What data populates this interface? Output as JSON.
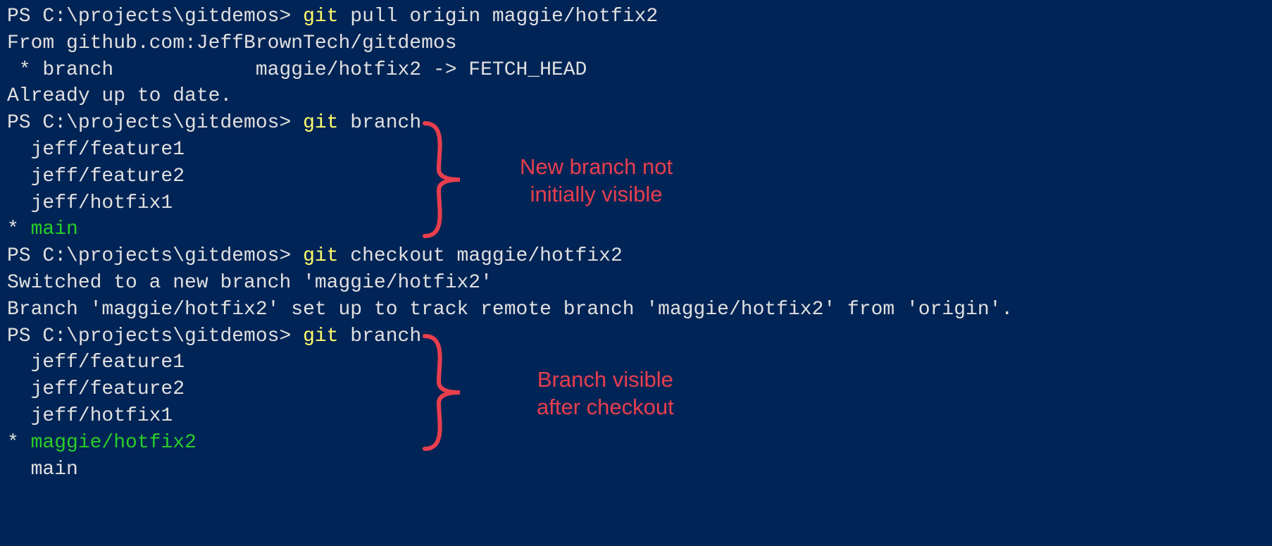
{
  "colors": {
    "background": "#012456",
    "text": "#e0e0e0",
    "yellow": "#ffff6b",
    "green": "#28ce28",
    "annotation": "#e83e4d"
  },
  "lines": {
    "l1_prompt": "PS C:\\projects\\gitdemos> ",
    "l1_git": "git",
    "l1_rest": " pull origin maggie/hotfix2",
    "l2": "From github.com:JeffBrownTech/gitdemos",
    "l3": " * branch            maggie/hotfix2 -> FETCH_HEAD",
    "l4": "Already up to date.",
    "l5_prompt": "PS C:\\projects\\gitdemos> ",
    "l5_git": "git",
    "l5_rest": " branch",
    "l6": "  jeff/feature1",
    "l7": "  jeff/feature2",
    "l8": "  jeff/hotfix1",
    "l9_star": "* ",
    "l9_branch": "main",
    "l10_prompt": "PS C:\\projects\\gitdemos> ",
    "l10_git": "git",
    "l10_rest": " checkout maggie/hotfix2",
    "l11": "Switched to a new branch 'maggie/hotfix2'",
    "l12": "Branch 'maggie/hotfix2' set up to track remote branch 'maggie/hotfix2' from 'origin'.",
    "l13_prompt": "PS C:\\projects\\gitdemos> ",
    "l13_git": "git",
    "l13_rest": " branch",
    "l14": "  jeff/feature1",
    "l15": "  jeff/feature2",
    "l16": "  jeff/hotfix1",
    "l17_star": "* ",
    "l17_branch": "maggie/hotfix2",
    "l18": "  main"
  },
  "annotations": {
    "a1_l1": "New branch not",
    "a1_l2": "initially visible",
    "a2_l1": "Branch visible",
    "a2_l2": "after checkout"
  }
}
